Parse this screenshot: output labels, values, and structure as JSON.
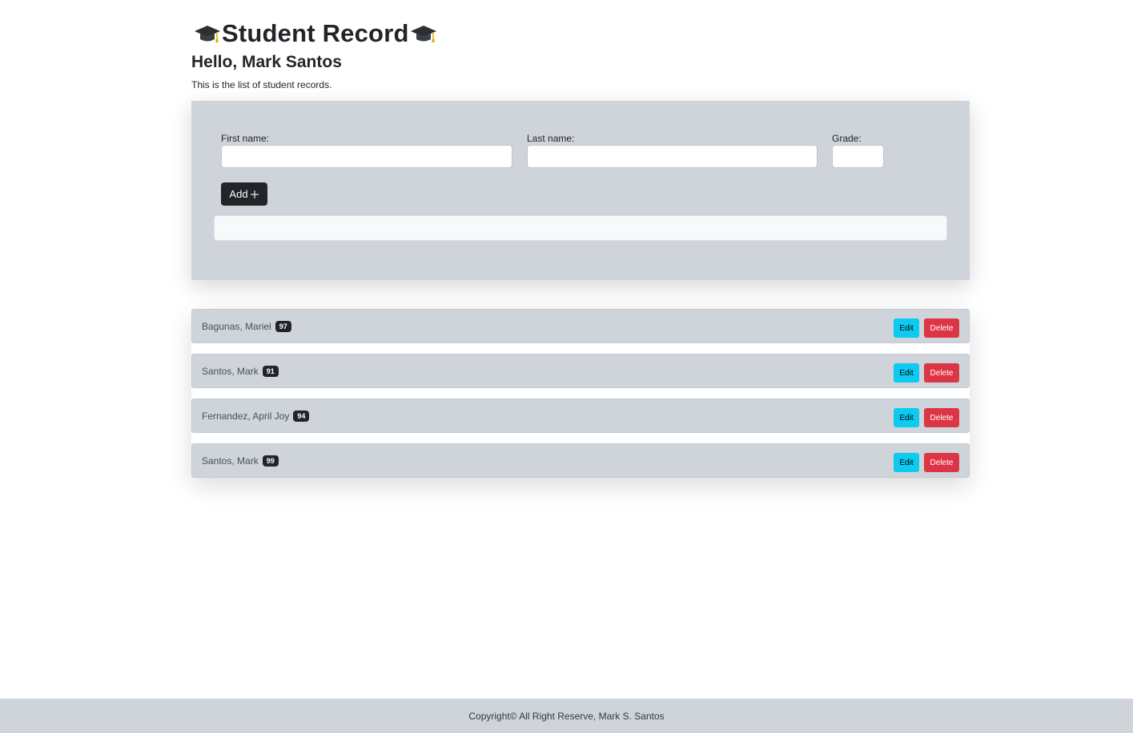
{
  "header": {
    "title": "Student Record",
    "cap_icon": "graduation-cap-icon",
    "greeting": "Hello, Mark Santos",
    "subtitle": "This is the list of student records."
  },
  "form": {
    "first_name_label": "First name:",
    "first_name_value": "",
    "last_name_label": "Last name:",
    "last_name_value": "",
    "grade_label": "Grade:",
    "grade_value": "",
    "add_label": "Add",
    "add_icon": "plus-icon",
    "message": ""
  },
  "students": [
    {
      "name": "Bagunas, Mariel",
      "grade": "97"
    },
    {
      "name": "Santos, Mark",
      "grade": "91"
    },
    {
      "name": "Fernandez, April Joy",
      "grade": "94"
    },
    {
      "name": "Santos, Mark",
      "grade": "99"
    }
  ],
  "actions": {
    "edit_label": "Edit",
    "delete_label": "Delete"
  },
  "colors": {
    "card_bg": "#ced4da",
    "edit": "#0dcaf0",
    "delete": "#dc3545",
    "dark": "#212529"
  },
  "footer": {
    "text": "Copyright© All Right Reserve, Mark S. Santos"
  }
}
